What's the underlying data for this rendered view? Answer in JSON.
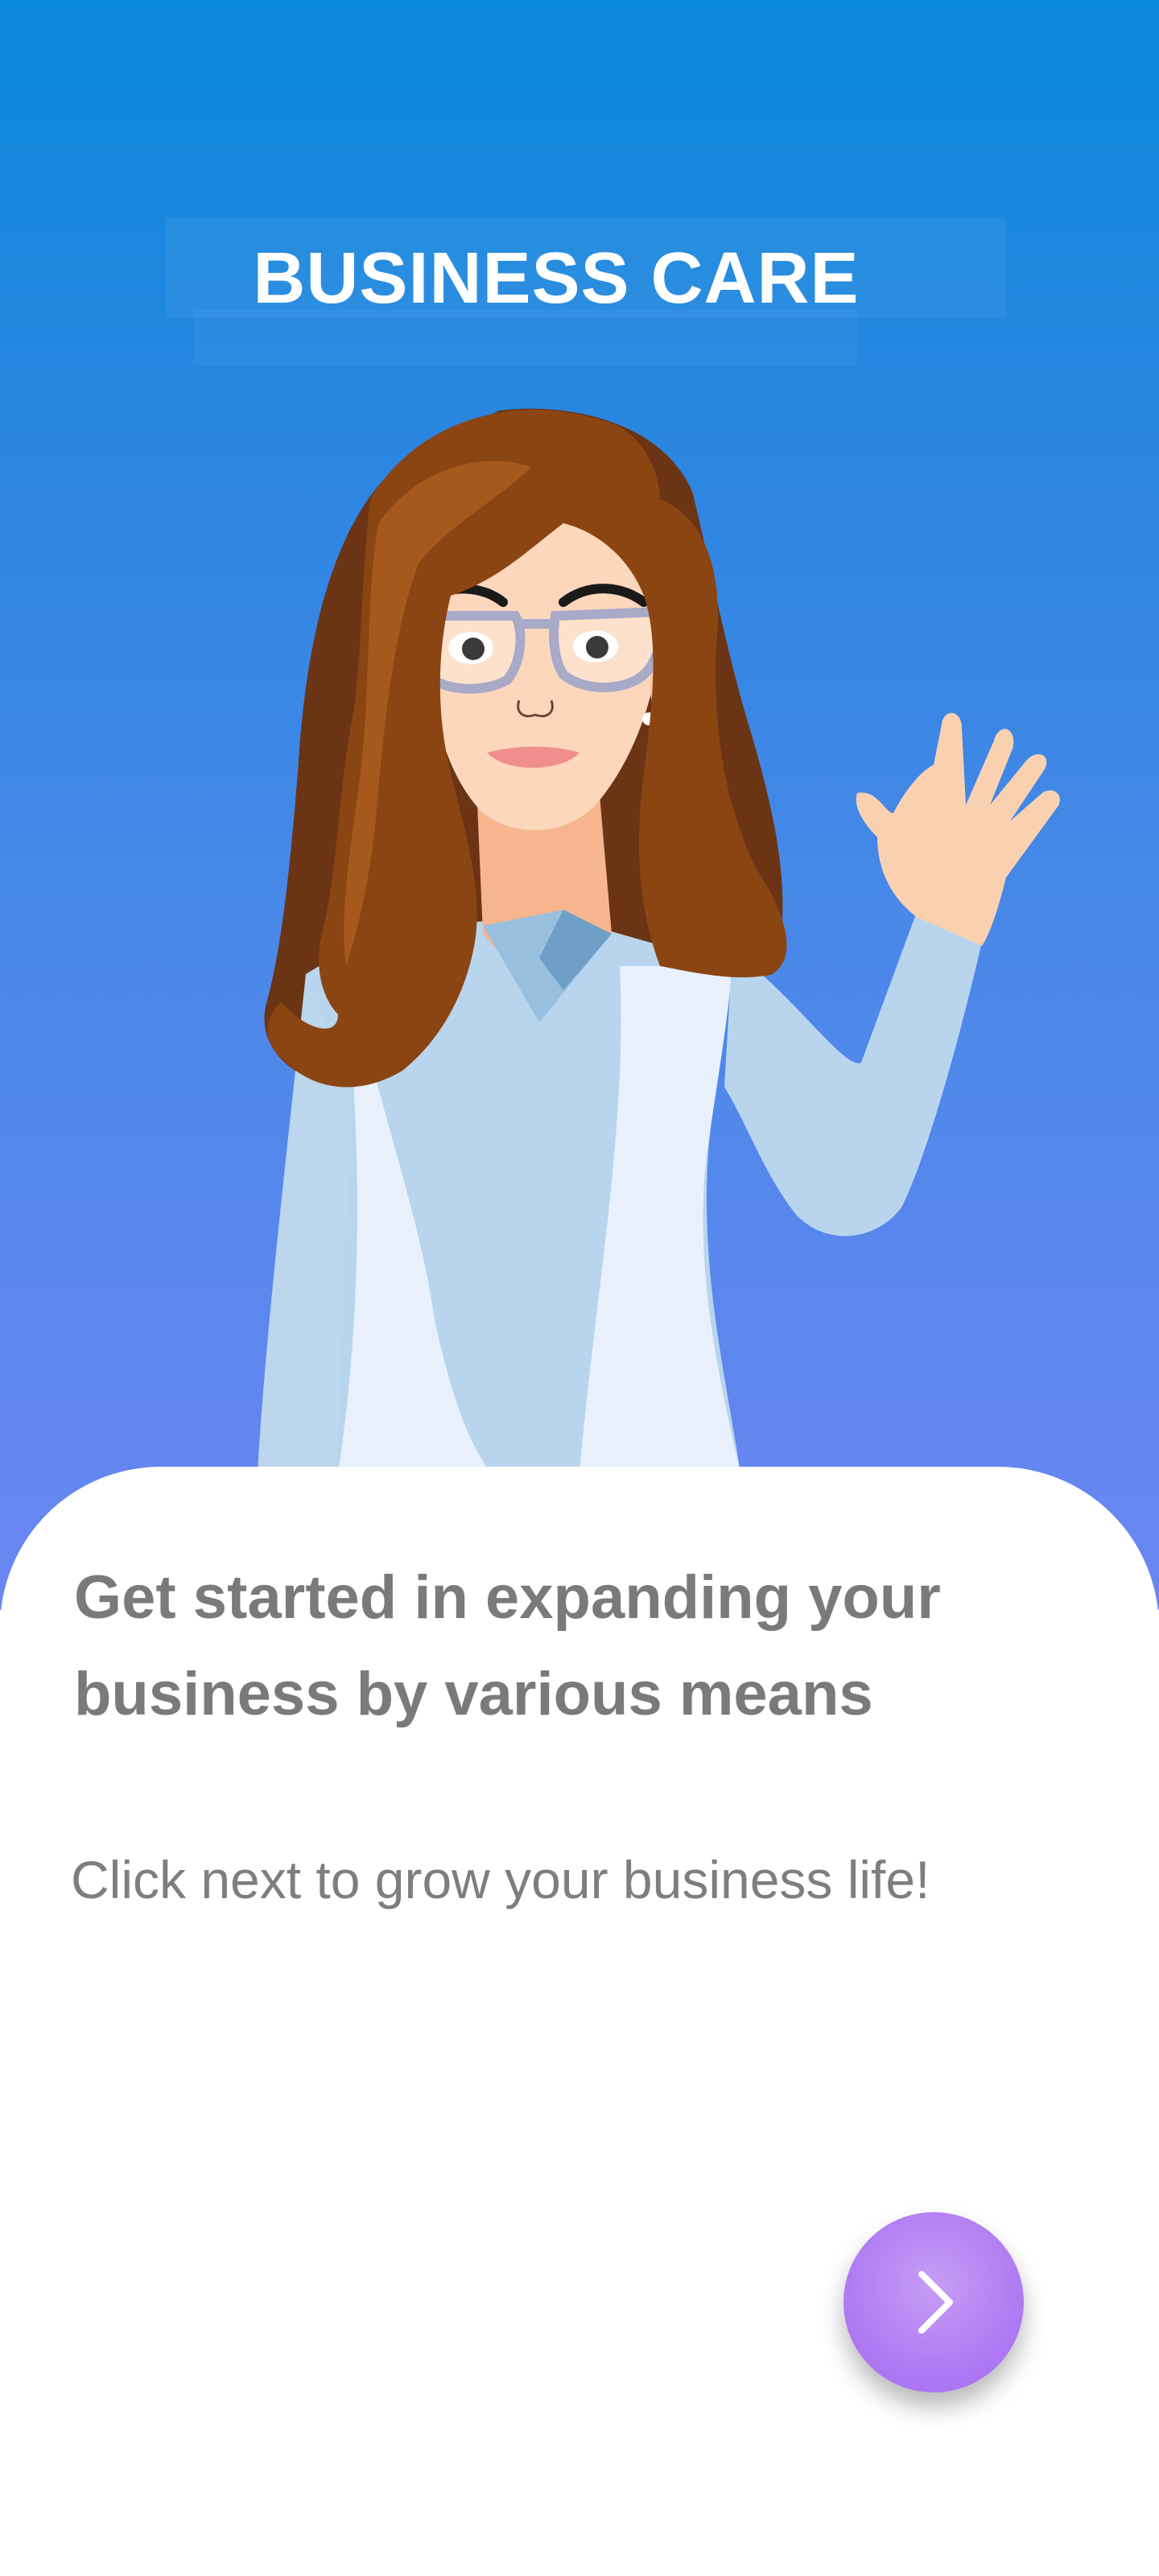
{
  "header": {
    "brand_title": "BUSINESS CARE"
  },
  "main": {
    "headline": "Get started in expanding your business by various means",
    "subtext": "Click next to grow your business life!"
  },
  "actions": {
    "next_icon": "chevron-right-icon"
  },
  "colors": {
    "hero_gradient_top": "#0a88da",
    "hero_gradient_bottom": "#6b86f2",
    "headline_text": "#7a7a7a",
    "next_button": "#b07cf3"
  }
}
